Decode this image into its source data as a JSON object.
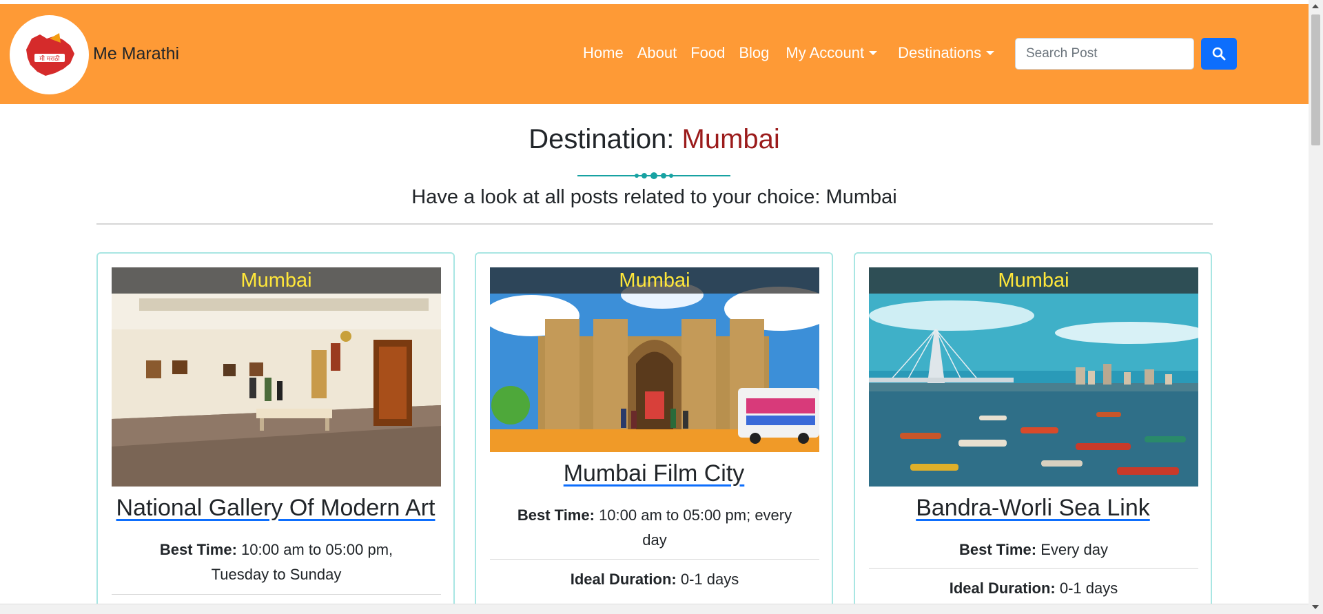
{
  "brand": {
    "name": "Me Marathi",
    "logo_text": "मी मराठी"
  },
  "nav": {
    "links": [
      "Home",
      "About",
      "Food",
      "Blog"
    ],
    "my_account": "My Account",
    "destinations": "Destinations",
    "search_placeholder": "Search Post"
  },
  "header": {
    "title_prefix": "Destination:",
    "title_city": "Mumbai",
    "subtitle": "Have a look at all posts related to your choice: Mumbai"
  },
  "cards": [
    {
      "tag": "Mumbai",
      "title": "National Gallery Of Modern Art",
      "best_time_label": "Best Time:",
      "best_time": "10:00 am to 05:00 pm,",
      "best_time_2": "Tuesday to Sunday"
    },
    {
      "tag": "Mumbai",
      "title": "Mumbai Film City",
      "best_time_label": "Best Time:",
      "best_time": "10:00 am to 05:00 pm; every",
      "best_time_2": "day",
      "duration_label": "Ideal Duration:",
      "duration": "0-1 days"
    },
    {
      "tag": "Mumbai",
      "title": "Bandra-Worli Sea Link",
      "best_time_label": "Best Time:",
      "best_time": "Every day",
      "duration_label": "Ideal Duration:",
      "duration": "0-1 days"
    }
  ],
  "colors": {
    "navbar": "#fe9a36",
    "city_accent": "#9b1b1b",
    "image_tag_text": "#ffe73a",
    "card_border": "#a8e6e3",
    "search_button": "#0d6efd"
  },
  "icons": [
    "maharashtra-logo-icon",
    "search-icon",
    "caret-down-icon",
    "divider-ornament-icon"
  ]
}
